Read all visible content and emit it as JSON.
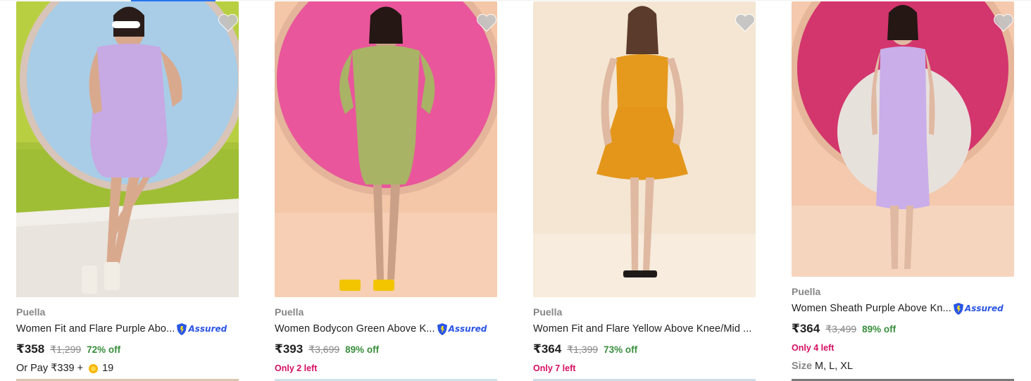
{
  "products": [
    {
      "brand": "Puella",
      "title": "Women Fit and Flare Purple Abo...",
      "assured": "Assured",
      "price": "₹358",
      "mrp": "₹1,299",
      "discount": "72% off",
      "orpay_prefix": "Or Pay ₹339 +",
      "coins": "19"
    },
    {
      "brand": "Puella",
      "title": "Women Bodycon Green Above K...",
      "assured": "Assured",
      "price": "₹393",
      "mrp": "₹3,699",
      "discount": "89% off",
      "stock": "Only 2 left"
    },
    {
      "brand": "Puella",
      "title": "Women Fit and Flare Yellow Above Knee/Mid ...",
      "price": "₹364",
      "mrp": "₹1,399",
      "discount": "73% off",
      "stock": "Only 7 left"
    },
    {
      "brand": "Puella",
      "title": "Women Sheath Purple Above Kn...",
      "assured": "Assured",
      "price": "₹364",
      "mrp": "₹3,499",
      "discount": "89% off",
      "stock": "Only 4 left",
      "size_label": "Size",
      "sizes": "M, L, XL"
    }
  ],
  "colors": {
    "brand_gray": "#878787",
    "discount_green": "#388e3c",
    "stock_pink": "#d50f62",
    "assured_blue": "#2a55e5"
  },
  "icons": [
    "heart-icon",
    "assured-shield-icon",
    "supercoin-icon"
  ]
}
